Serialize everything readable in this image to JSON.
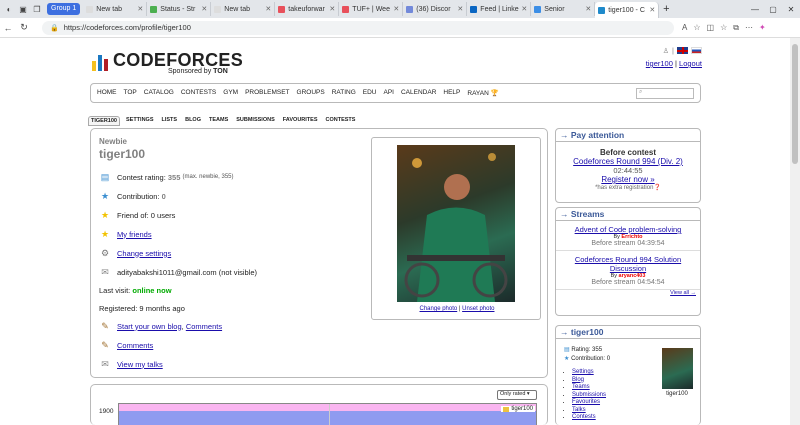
{
  "browser": {
    "group": "Group 1",
    "tabs": [
      {
        "label": "New tab",
        "color": "#dddddd"
      },
      {
        "label": "Status - Str",
        "color": "#4caf50"
      },
      {
        "label": "New tab",
        "color": "#dddddd"
      },
      {
        "label": "takeuforwar",
        "color": "#e8505b"
      },
      {
        "label": "TUF+ | Wee",
        "color": "#e8505b"
      },
      {
        "label": "(36) Discor",
        "color": "#7289da"
      },
      {
        "label": "Feed | Linke",
        "color": "#0a66c2"
      },
      {
        "label": "Senior",
        "color": "#3c8ee6"
      },
      {
        "label": "tiger100 - C",
        "color": "#1f8acb"
      }
    ],
    "url": "https://codeforces.com/profile/tiger100"
  },
  "header": {
    "logo_text": "CODEFORCES",
    "sponsor": "Sponsored by",
    "sponsor_brand": "TON",
    "user": "tiger100",
    "sep": "|",
    "logout": "Logout"
  },
  "menu": [
    "HOME",
    "TOP",
    "CATALOG",
    "CONTESTS",
    "GYM",
    "PROBLEMSET",
    "GROUPS",
    "RATING",
    "EDU",
    "API",
    "CALENDAR",
    "HELP",
    "RAYAN 🏆"
  ],
  "subtabs": [
    "TIGER100",
    "SETTINGS",
    "LISTS",
    "BLOG",
    "TEAMS",
    "SUBMISSIONS",
    "FAVOURITES",
    "CONTESTS"
  ],
  "profile": {
    "rank": "Newbie",
    "handle": "tiger100",
    "rating_label": "Contest rating:",
    "rating": "355",
    "rating_max": "(max. newbie, 355)",
    "contribution_label": "Contribution:",
    "contribution": "0",
    "friend_of": "Friend of: 0 users",
    "my_friends": "My friends",
    "change_settings": "Change settings",
    "email": "adityabakshi1011@gmail.com (not visible)",
    "last_visit_label": "Last visit:",
    "last_visit": "online now",
    "registered": "Registered: 9 months ago",
    "blog_link": "Start your own blog",
    "comma": ",",
    "comments_link1": "Comments",
    "comments": "Comments",
    "talks": "View my talks",
    "change_photo": "Change photo",
    "photo_sep": "|",
    "unset_photo": "Unset photo"
  },
  "graph": {
    "filter": "Only rated",
    "ytick": "1900",
    "legend": "tiger100"
  },
  "pay": {
    "title": "→ Pay attention",
    "subtitle": "Before contest",
    "contest": "Codeforces Round 994 (Div. 2)",
    "time": "02:44:55",
    "register": "Register now »",
    "note": "*has extra registration"
  },
  "streams": {
    "title": "→ Streams",
    "items": [
      {
        "title": "Advent of Code problem-solving",
        "by": "By",
        "author": "Errichto",
        "when": "Before stream 04:39:54"
      },
      {
        "title": "Codeforces Round 994 Solution Discussion",
        "by": "By",
        "author": "aryanc403",
        "when": "Before stream 04:54:54"
      }
    ],
    "view_all": "View all →"
  },
  "userbox": {
    "title": "→ tiger100",
    "rating": "Rating: 355",
    "contribution": "Contribution: 0",
    "links": [
      "Settings",
      "Blog",
      "Teams",
      "Submissions",
      "Favourites",
      "Talks",
      "Contests"
    ],
    "caption": "tiger100"
  },
  "colors": {
    "link": "#1a0dab",
    "online": "#0a0",
    "section_title": "#3b5998",
    "rank": "#808080"
  }
}
